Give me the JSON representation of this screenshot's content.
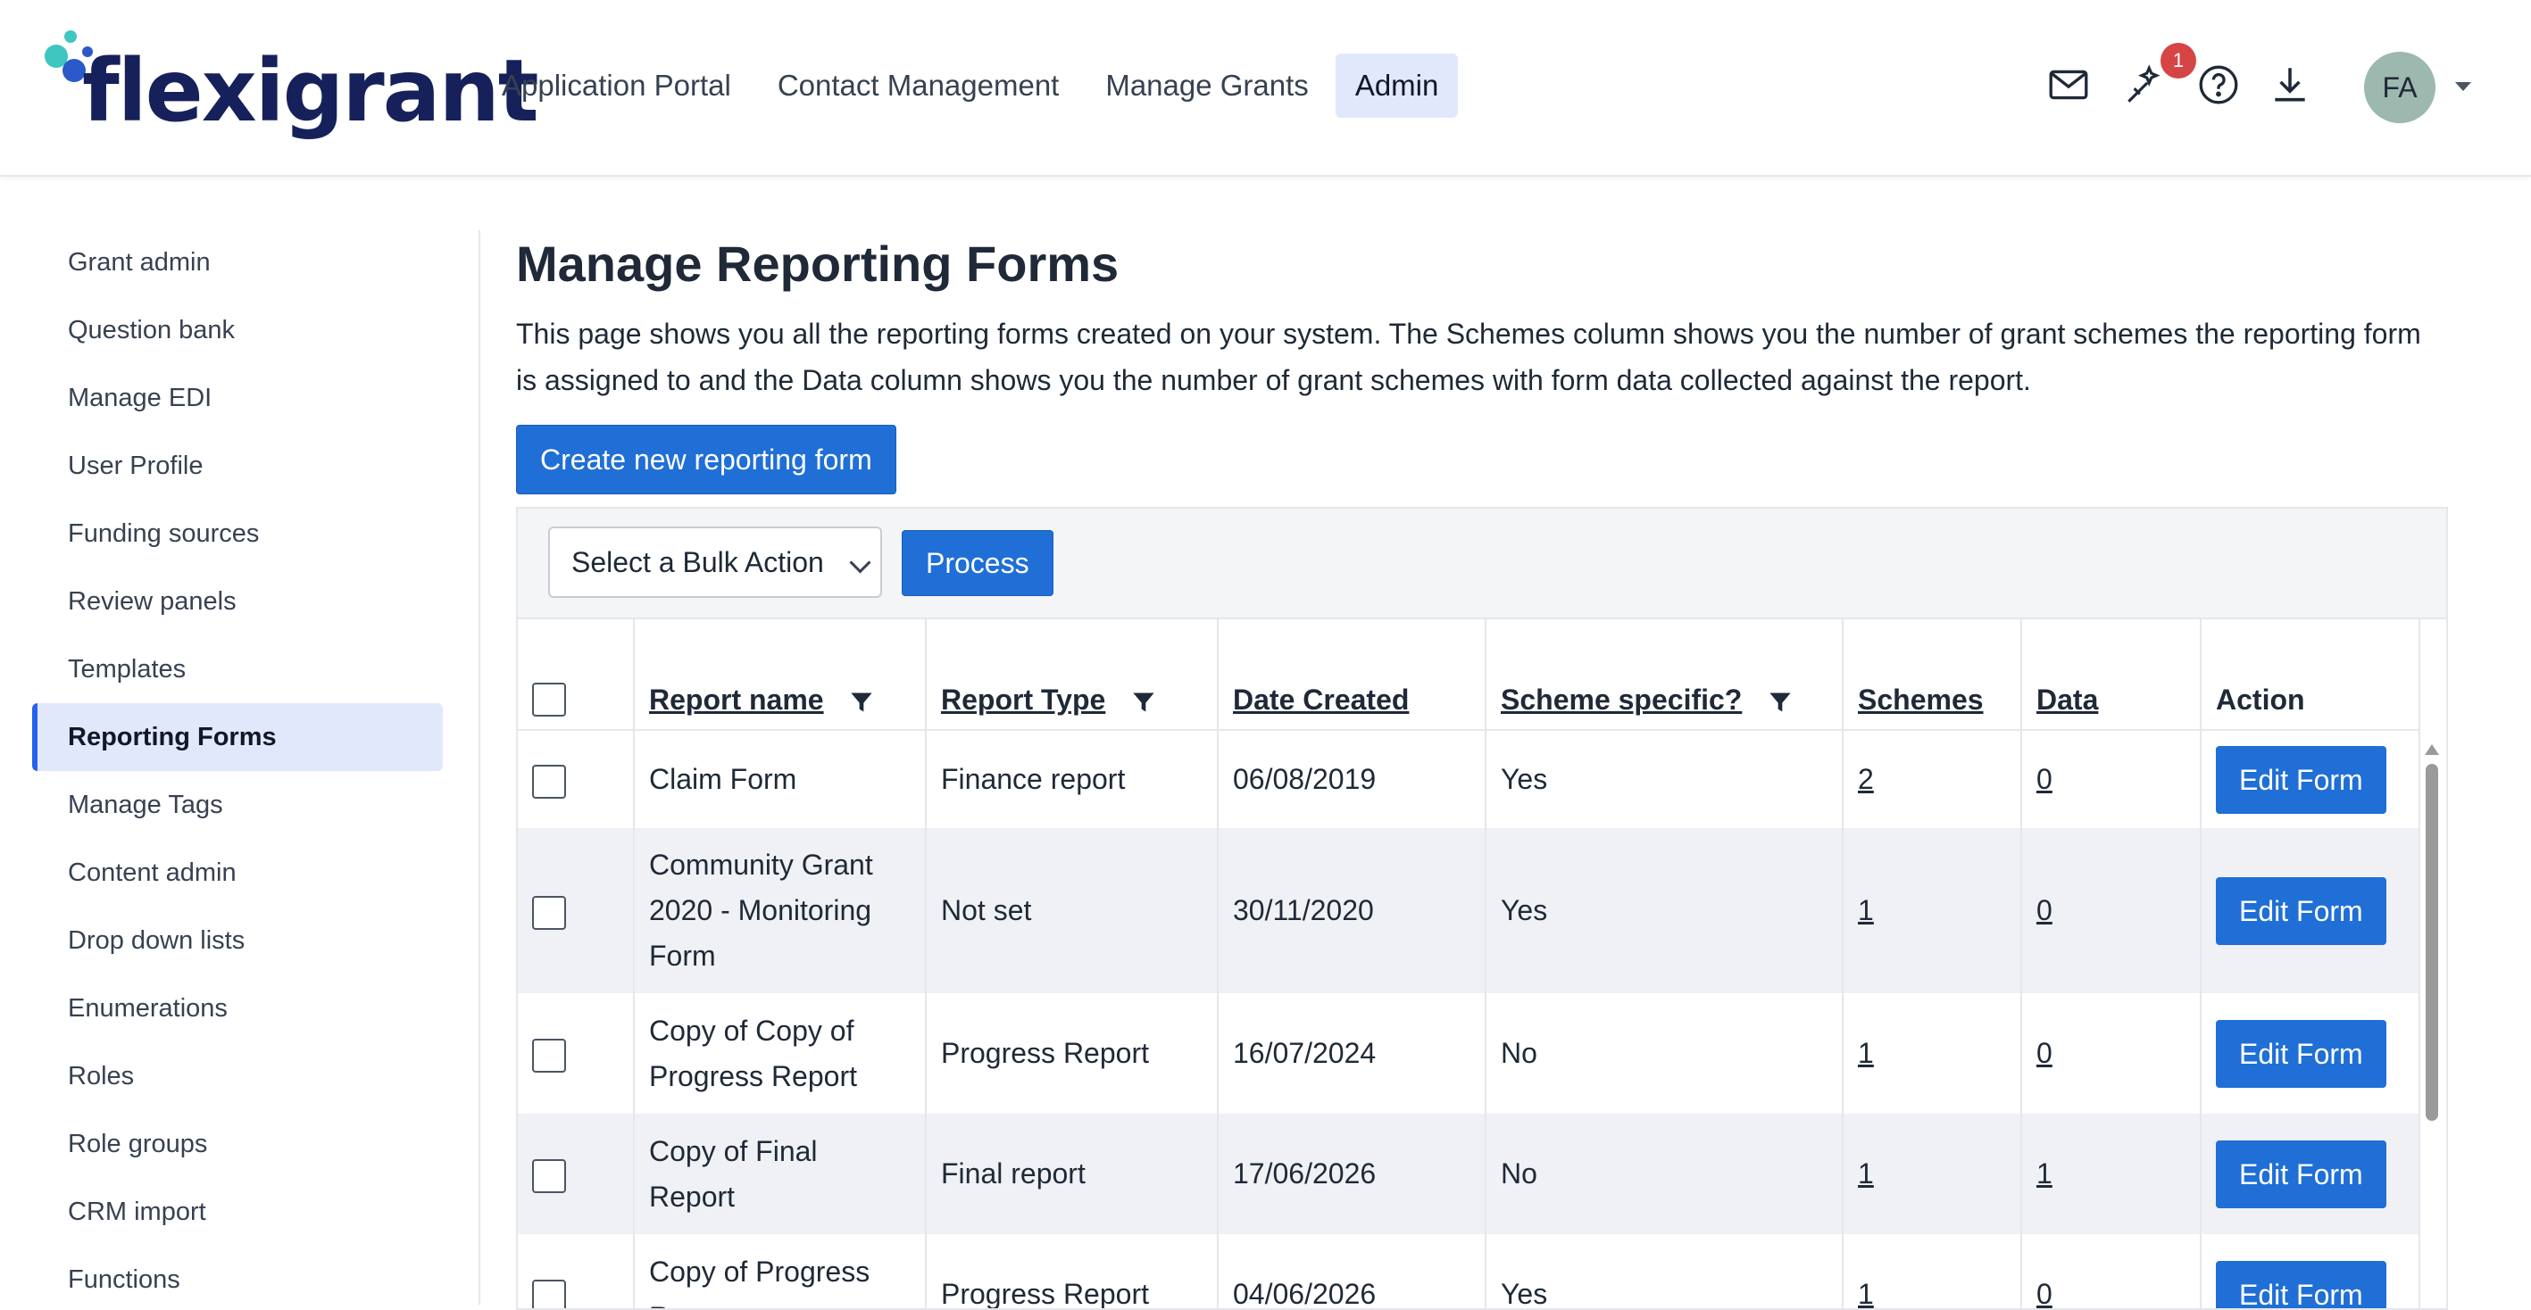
{
  "brand": {
    "name": "flexigrant"
  },
  "nav": {
    "items": [
      {
        "label": "Application Portal",
        "active": false
      },
      {
        "label": "Contact Management",
        "active": false
      },
      {
        "label": "Manage Grants",
        "active": false
      },
      {
        "label": "Admin",
        "active": true
      }
    ]
  },
  "header_icons": {
    "mail": "mail-icon",
    "notifications": "magic-wand-icon",
    "help": "help-circle-icon",
    "downloads": "download-icon",
    "notification_count": "1",
    "avatar_initials": "FA"
  },
  "sidebar": {
    "items": [
      {
        "label": "Grant admin"
      },
      {
        "label": "Question bank"
      },
      {
        "label": "Manage EDI"
      },
      {
        "label": "User Profile"
      },
      {
        "label": "Funding sources"
      },
      {
        "label": "Review panels"
      },
      {
        "label": "Templates"
      },
      {
        "label": "Reporting Forms",
        "active": true
      },
      {
        "label": "Manage Tags"
      },
      {
        "label": "Content admin"
      },
      {
        "label": "Drop down lists"
      },
      {
        "label": "Enumerations"
      },
      {
        "label": "Roles"
      },
      {
        "label": "Role groups"
      },
      {
        "label": "CRM import"
      },
      {
        "label": "Functions"
      }
    ]
  },
  "main": {
    "title": "Manage Reporting Forms",
    "description": "This page shows you all the reporting forms created on your system. The Schemes column shows you the number of grant schemes the reporting form is assigned to and the Data column shows you the number of grant schemes with form data collected against the report.",
    "create_button": "Create new reporting form",
    "bulk_action_selected": "Select a Bulk Action",
    "process_button": "Process"
  },
  "table": {
    "headers": {
      "report_name": "Report name",
      "report_type": "Report Type",
      "date_created": "Date Created",
      "scheme_specific": "Scheme specific?",
      "schemes": "Schemes",
      "data": "Data",
      "action": "Action"
    },
    "edit_label": "Edit Form",
    "rows": [
      {
        "name": "Claim Form",
        "type": "Finance report",
        "date": "06/08/2019",
        "specific": "Yes",
        "schemes": "2",
        "data": "0"
      },
      {
        "name": "Community Grant 2020 - Monitoring Form",
        "type": "Not set",
        "date": "30/11/2020",
        "specific": "Yes",
        "schemes": "1",
        "data": "0"
      },
      {
        "name": "Copy of Copy of Progress Report",
        "type": "Progress Report",
        "date": "16/07/2024",
        "specific": "No",
        "schemes": "1",
        "data": "0"
      },
      {
        "name": "Copy of Final Report",
        "type": "Final report",
        "date": "17/06/2026",
        "specific": "No",
        "schemes": "1",
        "data": "1"
      },
      {
        "name": "Copy of Progress Report",
        "type": "Progress Report",
        "date": "04/06/2026",
        "specific": "Yes",
        "schemes": "1",
        "data": "0"
      }
    ]
  },
  "colors": {
    "primary": "#1f6fd6",
    "active_bg": "#e2e8fb",
    "brand_navy": "#16215b",
    "badge": "#d64545"
  }
}
